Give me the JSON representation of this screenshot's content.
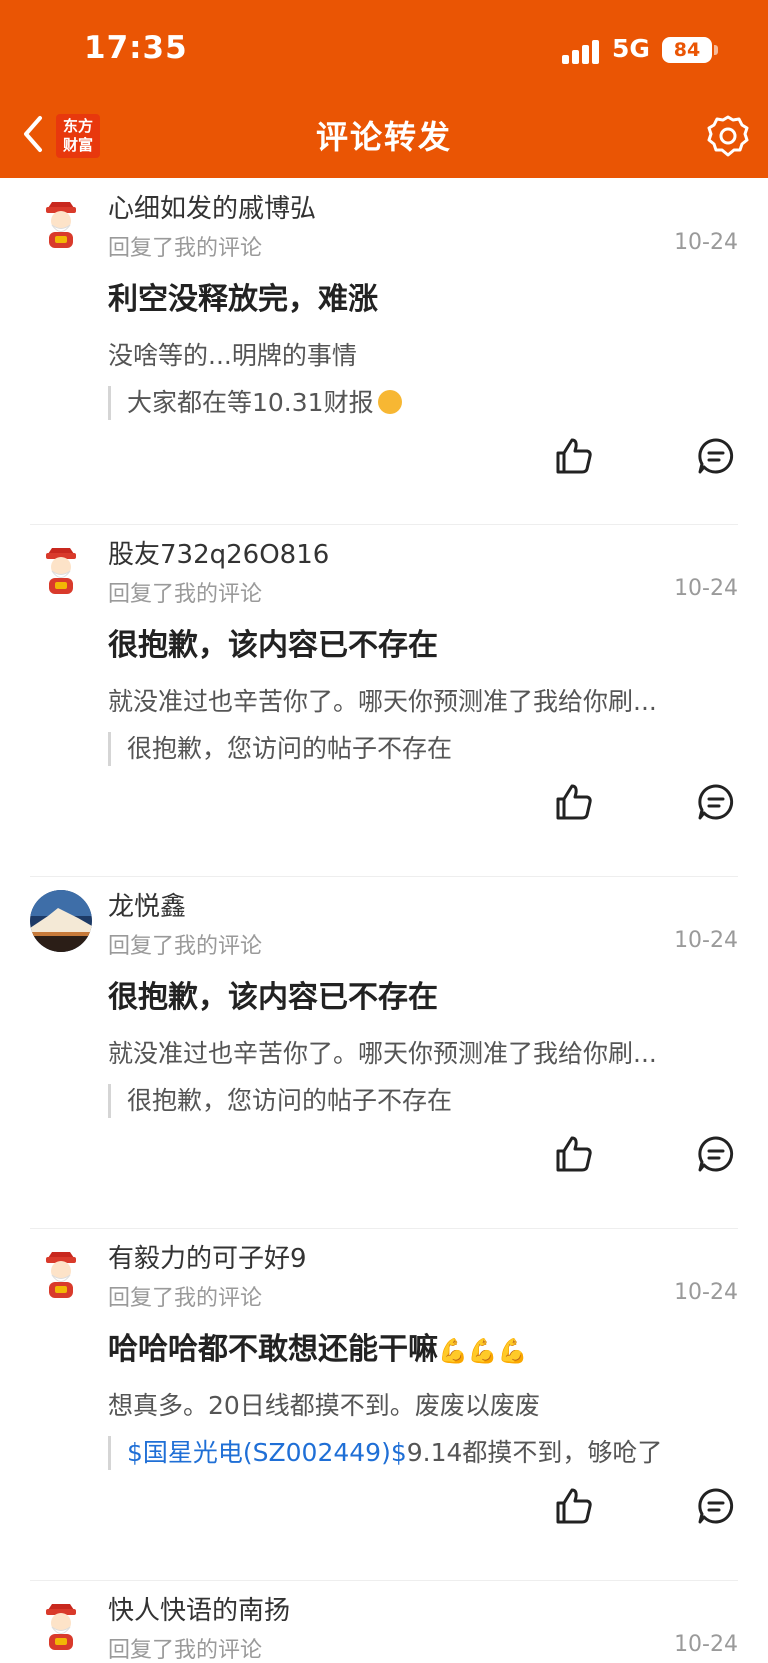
{
  "status_bar": {
    "time": "17:35",
    "network": "5G",
    "battery": "84"
  },
  "nav": {
    "back_icon": "chevron-left-icon",
    "logo_line1": "东方",
    "logo_line2": "财富",
    "title": "评论转发",
    "settings_icon": "gear-icon"
  },
  "colors": {
    "header": "#ea5504",
    "link": "#1f6fd6",
    "muted": "#9a9a9a"
  },
  "comments": [
    {
      "username": "心细如发的戚博弘",
      "reply_label": "回复了我的评论",
      "date": "10-24",
      "main_text": "利空没释放完，难涨",
      "sub_text": "没啥等的...明牌的事情",
      "quote_text": "大家都在等10.31财报",
      "avatar": "fortune-god-avatar"
    },
    {
      "username": "股友732q26O816",
      "reply_label": "回复了我的评论",
      "date": "10-24",
      "main_text": "很抱歉，该内容已不存在",
      "sub_text": "就没准过也辛苦你了。哪天你预测准了我给你刷...",
      "quote_text": "很抱歉，您访问的帖子不存在",
      "avatar": "fortune-god-avatar"
    },
    {
      "username": "龙悦鑫",
      "reply_label": "回复了我的评论",
      "date": "10-24",
      "main_text": "很抱歉，该内容已不存在",
      "sub_text": "就没准过也辛苦你了。哪天你预测准了我给你刷...",
      "quote_text": "很抱歉，您访问的帖子不存在",
      "avatar": "mountain-photo-avatar"
    },
    {
      "username": "有毅力的可子好9",
      "reply_label": "回复了我的评论",
      "date": "10-24",
      "main_text": "哈哈哈都不敢想还能干嘛",
      "sub_text": "想真多。20日线都摸不到。废废以废废",
      "quote_link": "$国星光电(SZ002449)$",
      "quote_text": "9.14都摸不到，够呛了",
      "avatar": "fortune-god-avatar"
    },
    {
      "username": "快人快语的南扬",
      "reply_label": "回复了我的评论",
      "date": "10-24",
      "avatar": "fortune-god-avatar"
    }
  ]
}
